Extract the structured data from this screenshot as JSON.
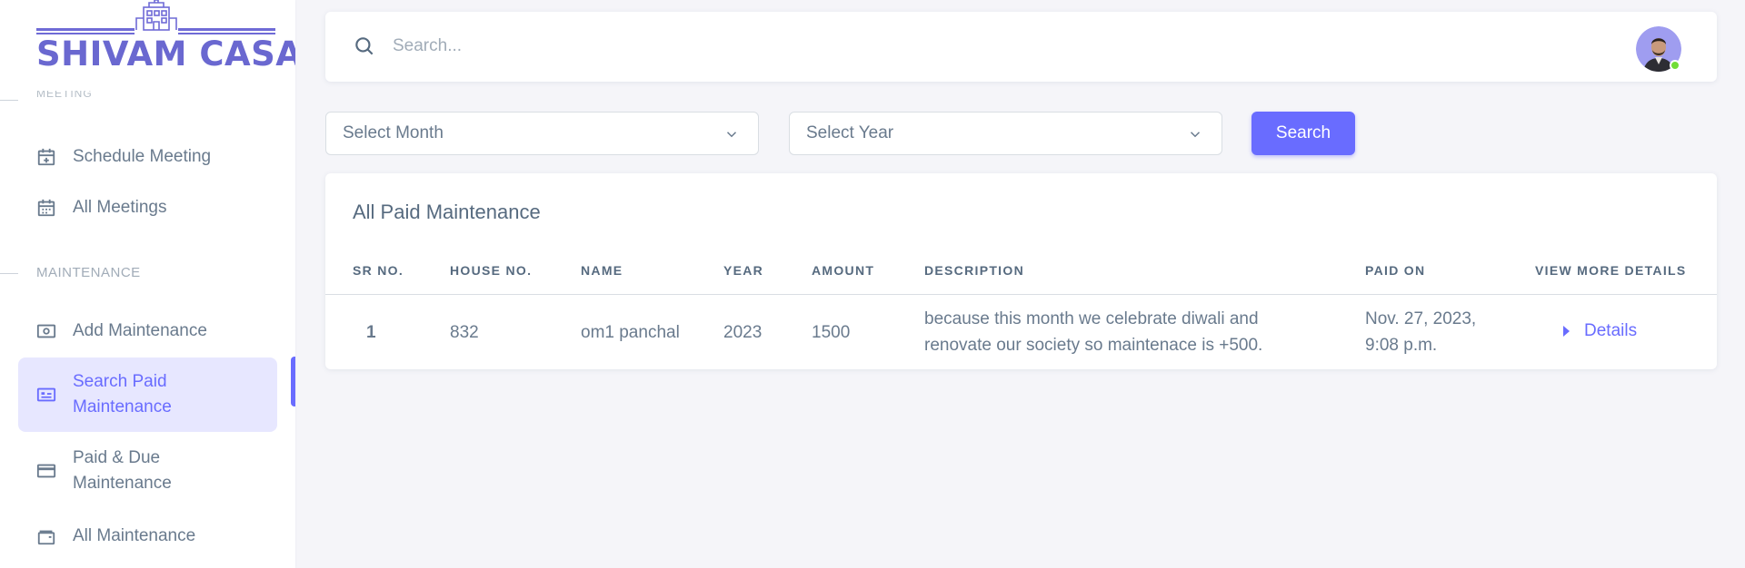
{
  "brand": {
    "name": "SHIVAM CASA"
  },
  "sidebar": {
    "cut_header": "MEETING",
    "items_top": [
      {
        "label": "Schedule Meeting",
        "icon": "calendar-plus-icon"
      },
      {
        "label": "All Meetings",
        "icon": "calendar-icon"
      }
    ],
    "section_header": "MAINTENANCE",
    "items": [
      {
        "label": "Add Maintenance",
        "icon": "money-icon"
      },
      {
        "label": "Search Paid Maintenance",
        "icon": "id-card-icon",
        "active": true
      },
      {
        "label": "Paid & Due Maintenance",
        "icon": "credit-card-icon"
      },
      {
        "label": "All Maintenance",
        "icon": "wallet-icon"
      }
    ]
  },
  "topbar": {
    "search_placeholder": "Search..."
  },
  "filters": {
    "month_placeholder": "Select Month",
    "year_placeholder": "Select Year",
    "search_button": "Search"
  },
  "card": {
    "title": "All Paid Maintenance",
    "columns": [
      "SR NO.",
      "HOUSE NO.",
      "NAME",
      "YEAR",
      "AMOUNT",
      "DESCRIPTION",
      "PAID ON",
      "VIEW MORE DETAILS"
    ],
    "rows": [
      {
        "sr": "1",
        "house": "832",
        "name": "om1 panchal",
        "year": "2023",
        "amount": "1500",
        "description_line1": "because this month we celebrate diwali and",
        "description_line2": "renovate our society so maintenace is +500.",
        "paid_on_line1": "Nov. 27, 2023,",
        "paid_on_line2": "9:08 p.m.",
        "details": "Details"
      }
    ]
  },
  "colors": {
    "primary": "#696cff",
    "active_bg": "#e7e7ff",
    "online": "#71dd37"
  }
}
